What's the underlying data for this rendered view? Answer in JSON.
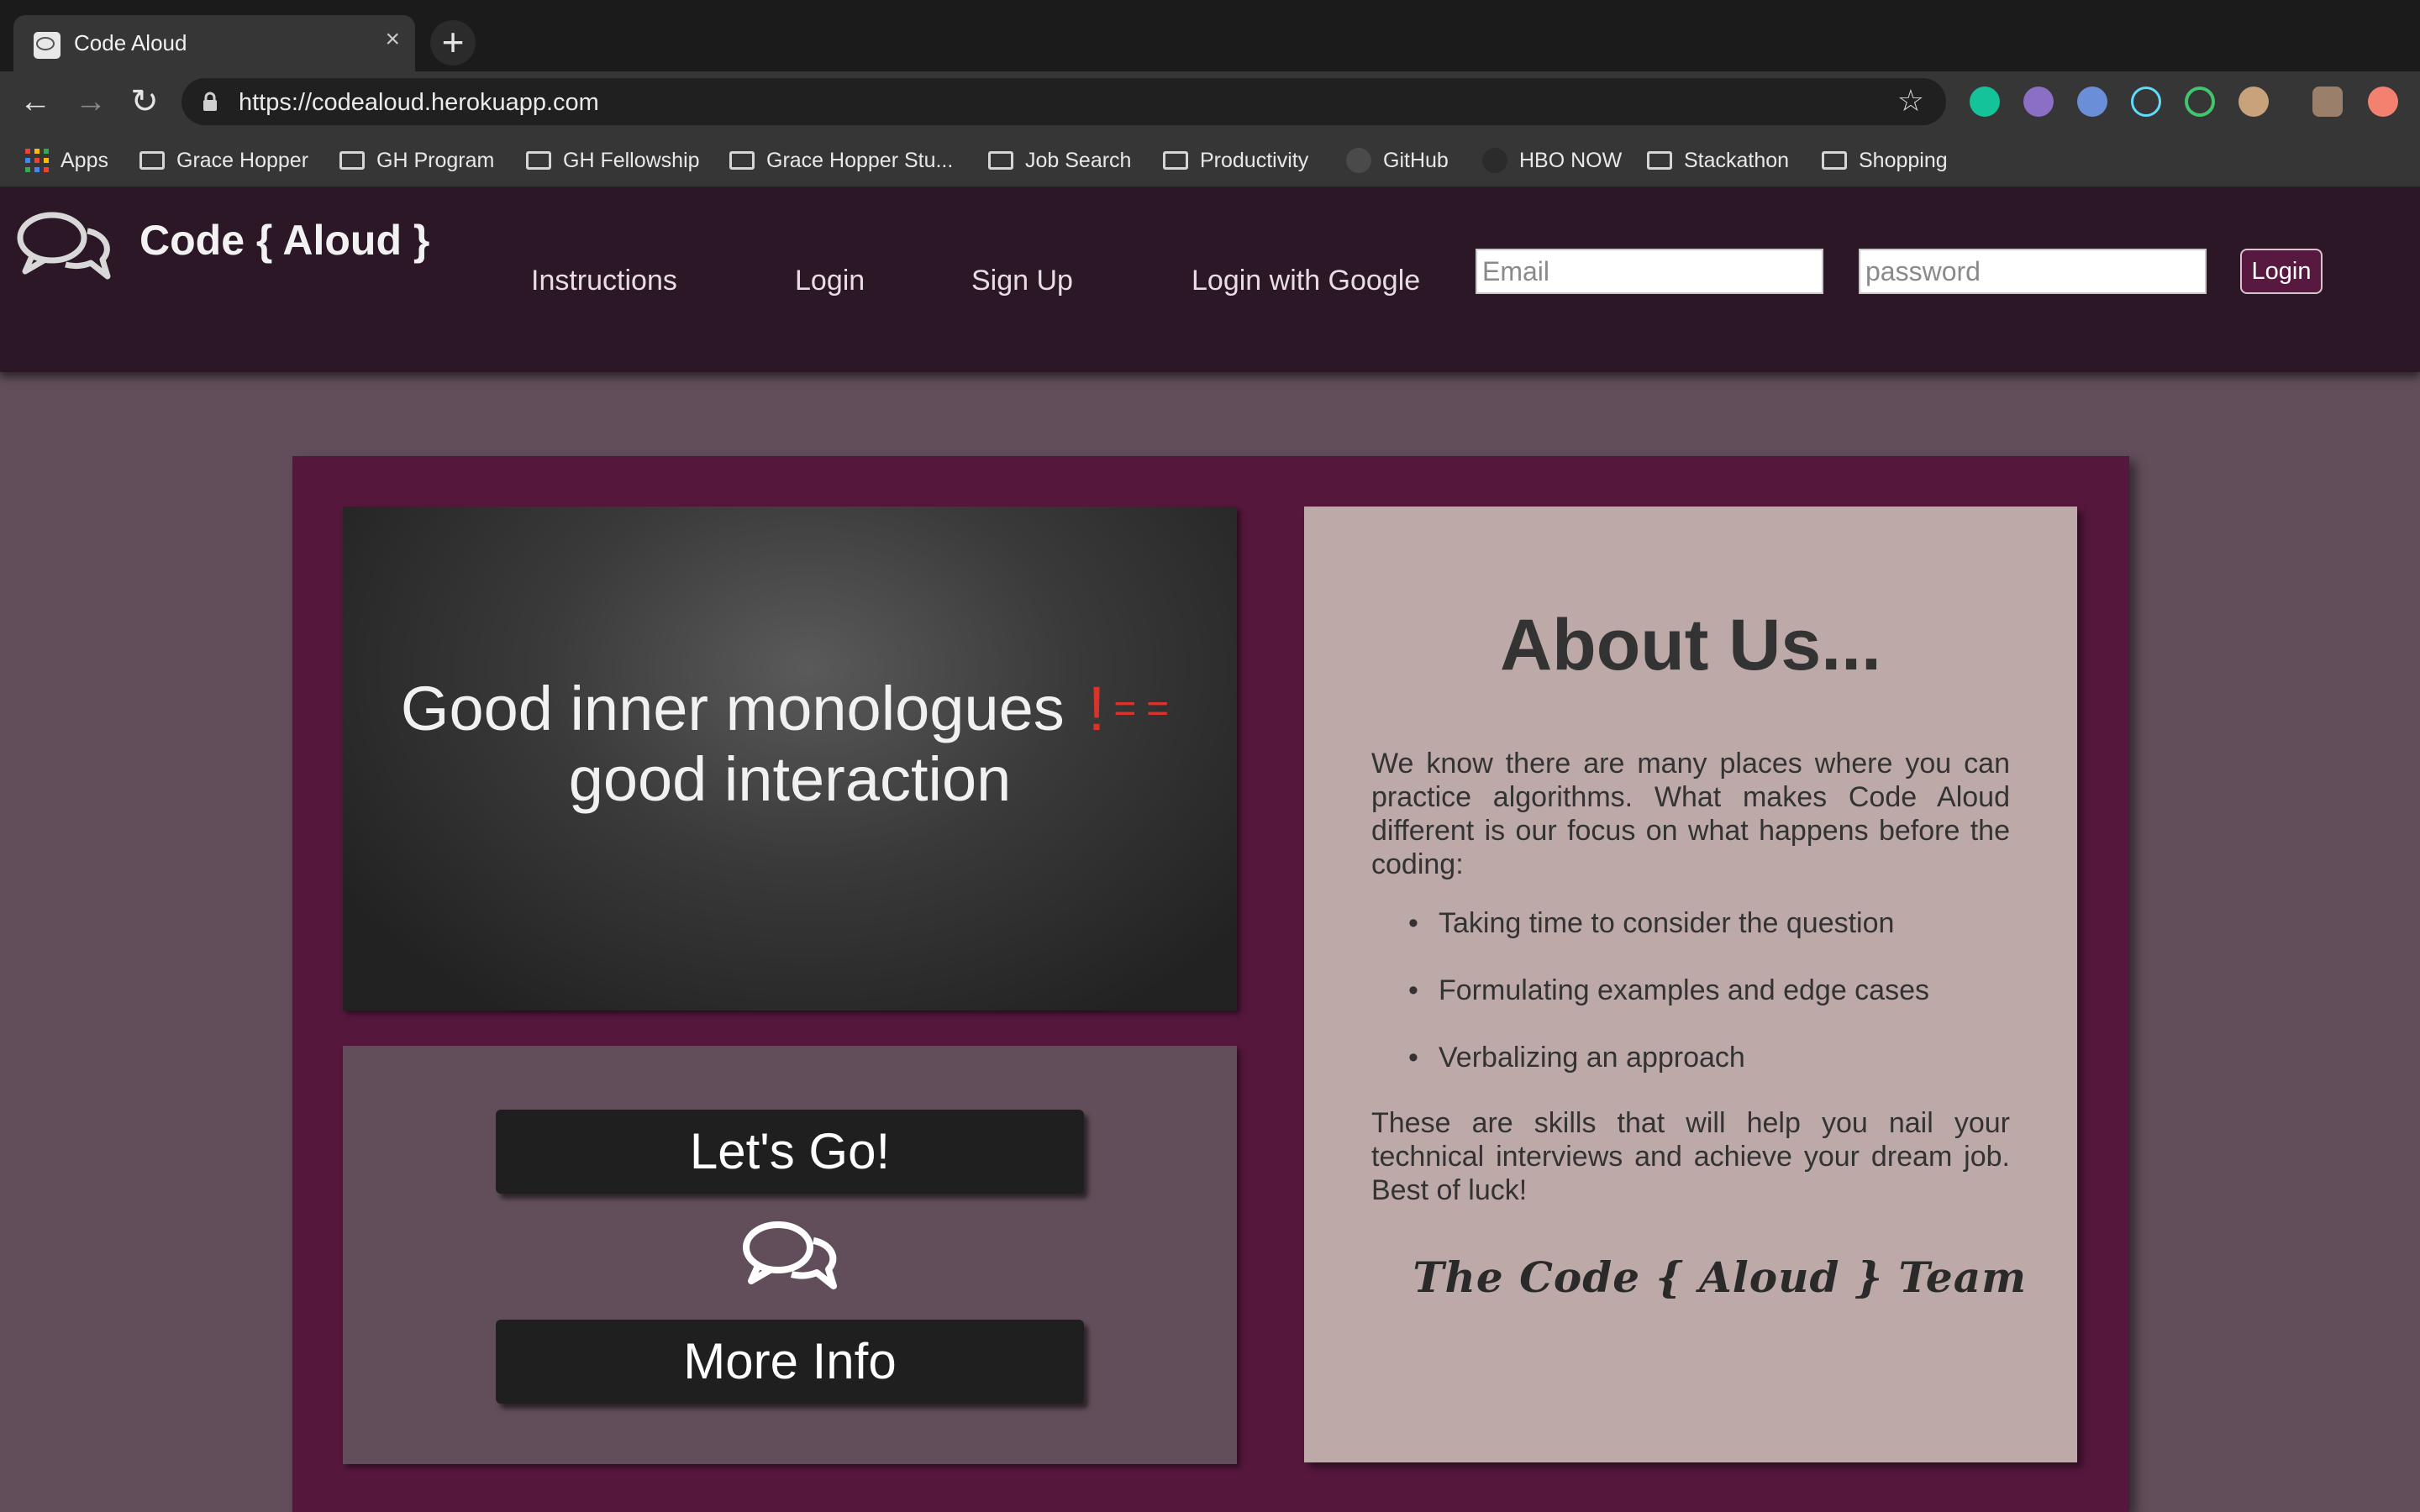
{
  "browser": {
    "tab_title": "Code Aloud",
    "tab_close": "×",
    "new_tab": "+",
    "url": "https://codealoud.herokuapp.com",
    "bookmarks": [
      {
        "label": "Apps",
        "icon": "apps-grid-icon"
      },
      {
        "label": "Grace Hopper",
        "icon": "folder-icon"
      },
      {
        "label": "GH Program",
        "icon": "folder-icon"
      },
      {
        "label": "GH Fellowship",
        "icon": "folder-icon"
      },
      {
        "label": "Grace Hopper Stu...",
        "icon": "folder-icon"
      },
      {
        "label": "Job Search",
        "icon": "folder-icon"
      },
      {
        "label": "Productivity",
        "icon": "folder-icon"
      },
      {
        "label": "GitHub",
        "icon": "github-icon"
      },
      {
        "label": "HBO NOW",
        "icon": "hbo-icon"
      },
      {
        "label": "Stackathon",
        "icon": "folder-icon"
      },
      {
        "label": "Shopping",
        "icon": "folder-icon"
      }
    ]
  },
  "header": {
    "brand": "Code { Aloud }",
    "nav": [
      "Instructions",
      "Login",
      "Sign Up",
      "Login with Google"
    ],
    "email_placeholder": "Email",
    "password_placeholder": "password",
    "login_button": "Login"
  },
  "hero": {
    "line1": "Good inner monologues",
    "neq_bang": "!",
    "neq_eq": "==",
    "line2": "good interaction"
  },
  "cta": {
    "primary": "Let's Go!",
    "secondary": "More Info"
  },
  "about": {
    "title": "About Us...",
    "intro": "We know there are many places where you can practice algorithms. What makes Code Aloud different is our focus on what happens before the coding:",
    "points": [
      "Taking time to consider the question",
      "Formulating examples and edge cases",
      "Verbalizing an approach"
    ],
    "outro": "These are skills that will help you nail your technical interviews and achieve your dream job. Best of luck!",
    "signature": "The Code { Aloud } Team"
  },
  "colors": {
    "header_bg": "#2c1726",
    "page_bg": "#624e5a",
    "panel_bg": "#56173d",
    "about_bg": "#bca9a8",
    "neq_red": "#d9342b"
  }
}
